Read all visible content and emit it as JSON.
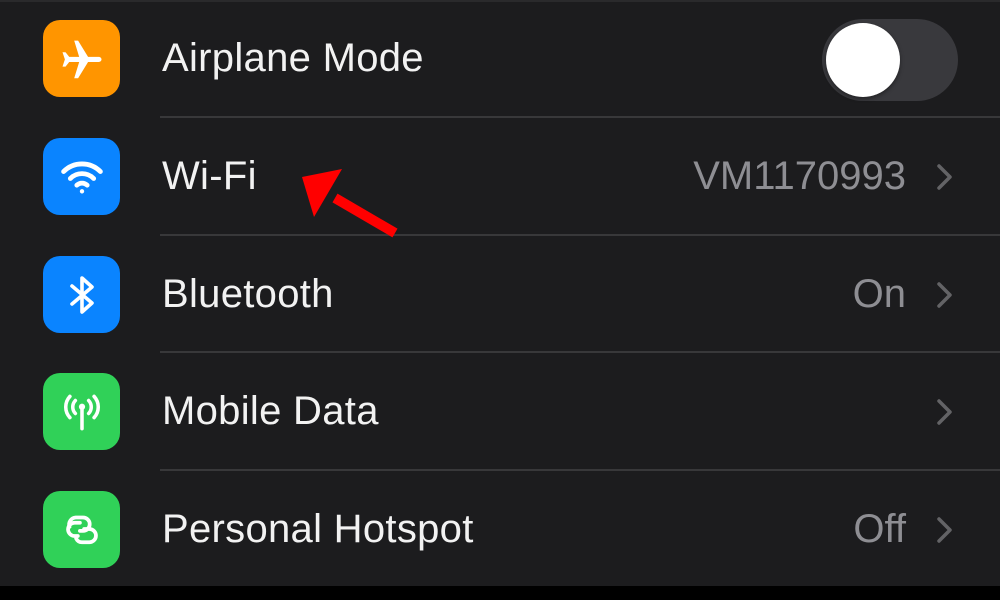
{
  "settings": {
    "rows": [
      {
        "id": "airplane-mode",
        "label": "Airplane Mode",
        "icon": "airplane-icon",
        "icon_color": "#ff9500",
        "control": "toggle",
        "toggle_on": false
      },
      {
        "id": "wifi",
        "label": "Wi-Fi",
        "icon": "wifi-icon",
        "icon_color": "#0a84ff",
        "value": "VM1170993",
        "control": "chevron"
      },
      {
        "id": "bluetooth",
        "label": "Bluetooth",
        "icon": "bluetooth-icon",
        "icon_color": "#0a84ff",
        "value": "On",
        "control": "chevron"
      },
      {
        "id": "mobile-data",
        "label": "Mobile Data",
        "icon": "antenna-icon",
        "icon_color": "#30d158",
        "value": "",
        "control": "chevron"
      },
      {
        "id": "personal-hotspot",
        "label": "Personal Hotspot",
        "icon": "hotspot-link-icon",
        "icon_color": "#30d158",
        "value": "Off",
        "control": "chevron"
      }
    ]
  },
  "annotation": {
    "type": "arrow",
    "color": "#ff0000",
    "points_to": "Wi-Fi"
  },
  "colors": {
    "background": "#1c1c1e",
    "label": "#f2f2f2",
    "secondary": "#8e8e93",
    "separator": "#38383a"
  }
}
